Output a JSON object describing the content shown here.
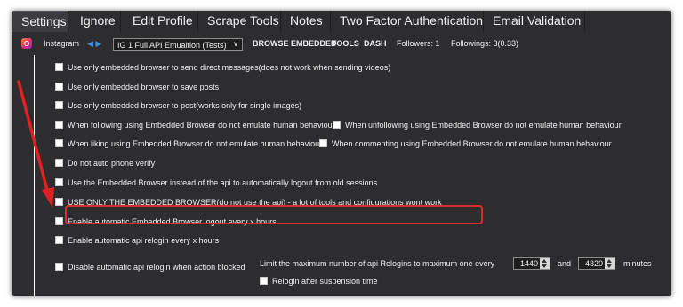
{
  "tabs": [
    "Settings",
    "Ignore",
    "Edit Profile",
    "Scrape Tools",
    "Notes",
    "Two Factor Authentication",
    "Email Validation"
  ],
  "toolbar": {
    "platform": "Instagram",
    "arrows": "◀ ▶",
    "api_select": "IG 1 Full API Emualtion (Tests)",
    "browse_embedded": "BROWSE EMBEDDED",
    "tools": "TOOLS",
    "dash": "DASH",
    "followers": "Followers: 1",
    "followings": "Followings: 3(0.33)"
  },
  "options": [
    "Use only embedded browser to send direct messages(does not work when sending videos)",
    "Use only embedded browser to save posts",
    "Use only embedded browser to post(works only for single images)",
    "When following using Embedded Browser do not emulate human behaviour",
    "When unfollowing using Embedded Browser do not emulate human behaviour",
    "When liking using Embedded Browser do not emulate human behaviour",
    "When commenting using Embedded Browser do not emulate human behaviour",
    "Do not auto phone verify",
    "Use the Embedded Browser instead of the api to automatically logout from old sessions",
    "USE ONLY THE EMBEDDED BROWSER(do not use the api) - a lot of tools and configurations wont work",
    "Enable automatic Embedded Browser logout every x hours",
    "Enable automatic api relogin every x hours",
    "Disable automatic api relogin when action blocked"
  ],
  "relogin": {
    "limit_text": "Limit the maximum number of api Relogins to maximum one every",
    "value1": "1440",
    "and_text": "and",
    "value2": "4320",
    "minutes_text": "minutes",
    "after_suspension": "Relogin after suspension time"
  },
  "colors": {
    "highlight": "#d92c2c",
    "arrow_color": "#e02020"
  }
}
